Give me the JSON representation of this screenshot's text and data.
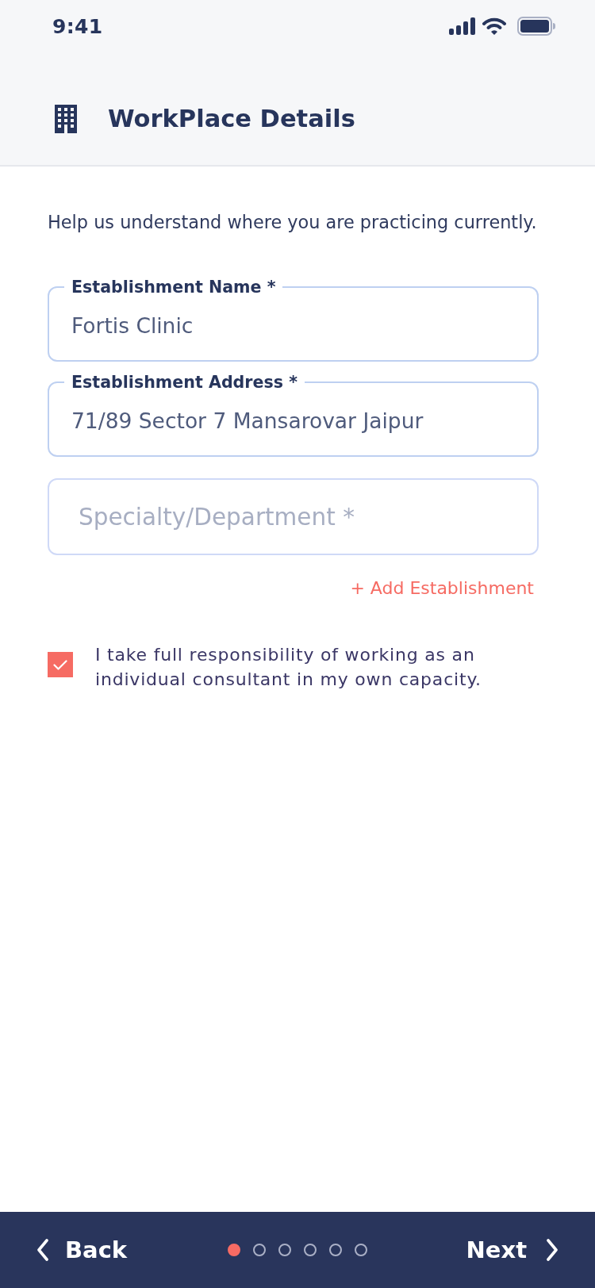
{
  "status_bar": {
    "time": "9:41"
  },
  "header": {
    "title": "WorkPlace Details"
  },
  "intro": "Help us understand where you are practicing currently.",
  "fields": [
    {
      "kind": "labeled",
      "label": "Establishment Name *",
      "value": "Fortis Clinic"
    },
    {
      "kind": "labeled",
      "label": "Establishment Address *",
      "value": "71/89 Sector 7 Mansarovar Jaipur"
    },
    {
      "kind": "empty",
      "placeholder": "Specialty/Department *"
    }
  ],
  "add_link": "+ Add Establishment",
  "agreement": {
    "text": "I take full responsibility of working as an individual consultant in my own capacity.",
    "checked": true
  },
  "footer": {
    "back": "Back",
    "next": "Next",
    "steps": [
      {
        "selected": true
      },
      {
        "selected": false
      },
      {
        "selected": false
      },
      {
        "selected": false
      },
      {
        "selected": false
      },
      {
        "selected": false
      }
    ]
  }
}
